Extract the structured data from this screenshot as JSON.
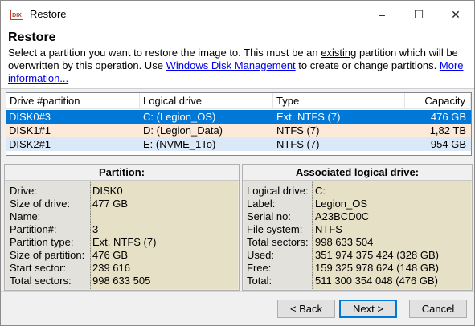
{
  "window": {
    "title": "Restore",
    "icon_text": "DIX"
  },
  "header": {
    "title": "Restore",
    "desc_part1": "Select a partition you want to restore the image to. This must be an ",
    "desc_existing": "existing",
    "desc_part2": " partition which will be overwritten by this operation. Use ",
    "link_disk_mgmt": "Windows Disk Management",
    "desc_part3": " to create or change partitions. ",
    "link_more": "More information..."
  },
  "table": {
    "columns": [
      "Drive #partition",
      "Logical drive",
      "Type",
      "Capacity"
    ],
    "rows": [
      {
        "drive": "DISK0#3",
        "logical": "C: (Legion_OS)",
        "type": "Ext. NTFS (7)",
        "capacity": "476 GB"
      },
      {
        "drive": "DISK1#1",
        "logical": "D: (Legion_Data)",
        "type": "NTFS (7)",
        "capacity": "1,82 TB"
      },
      {
        "drive": "DISK2#1",
        "logical": "E: (NVME_1To)",
        "type": "NTFS (7)",
        "capacity": "954 GB"
      }
    ]
  },
  "partition_panel": {
    "title": "Partition:",
    "labels": [
      "Drive:",
      "Size of drive:",
      "Name:",
      "Partition#:",
      "Partition type:",
      "Size of partition:",
      "Start sector:",
      "Total sectors:"
    ],
    "values": [
      "DISK0",
      "477 GB",
      "",
      "3",
      "Ext. NTFS (7)",
      "476 GB",
      "239 616",
      "998 633 505"
    ]
  },
  "logical_panel": {
    "title": "Associated logical drive:",
    "labels": [
      "Logical drive:",
      "Label:",
      "Serial no:",
      "File system:",
      "Total sectors:",
      "Used:",
      "Free:",
      "Total:"
    ],
    "values": [
      "C:",
      "Legion_OS",
      "A23BCD0C",
      "NTFS",
      "998 633 504",
      "351 974 375 424 (328 GB)",
      "159 325 978 624 (148 GB)",
      "511 300 354 048 (476 GB)"
    ]
  },
  "buttons": {
    "back": "< Back",
    "next": "Next >",
    "cancel": "Cancel"
  }
}
